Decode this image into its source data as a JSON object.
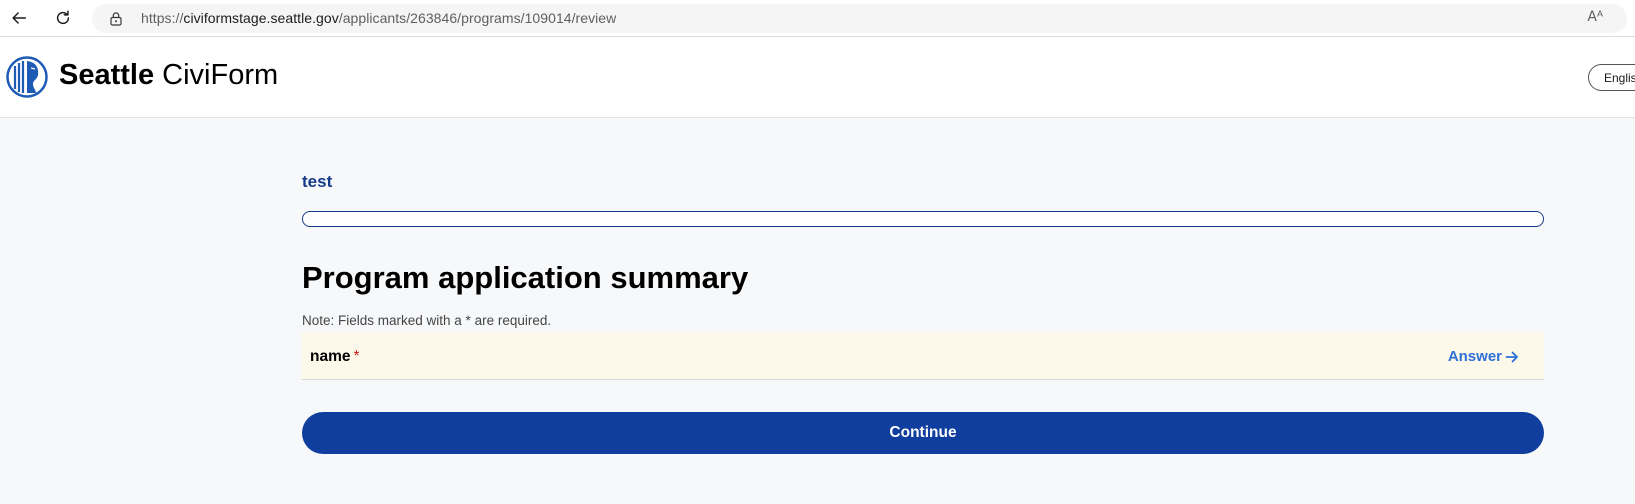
{
  "browser": {
    "url_prefix": "https://",
    "url_host": "civiformstage.seattle.gov",
    "url_path": "/applicants/263846/programs/109014/review",
    "read_aloud_label": "Aᴬ"
  },
  "header": {
    "brand_bold": "Seattle",
    "brand_regular": "CiviForm",
    "language_button": "English"
  },
  "main": {
    "program_name": "test",
    "progress": 0,
    "title": "Program application summary",
    "note": "Note: Fields marked with a * are required.",
    "questions": [
      {
        "label": "name",
        "required_marker": "*",
        "action_label": "Answer"
      }
    ],
    "continue_label": "Continue"
  },
  "colors": {
    "primary": "#103e9e",
    "link": "#2f6fd8",
    "required": "#c01e1e",
    "question_bg": "#fcf9ea",
    "page_bg": "#f7f8fa"
  },
  "icons": {
    "back": "back-arrow-icon",
    "reload": "reload-icon",
    "lock": "lock-icon",
    "logo": "seattle-seal-icon",
    "answer_arrow": "arrow-right-icon"
  }
}
